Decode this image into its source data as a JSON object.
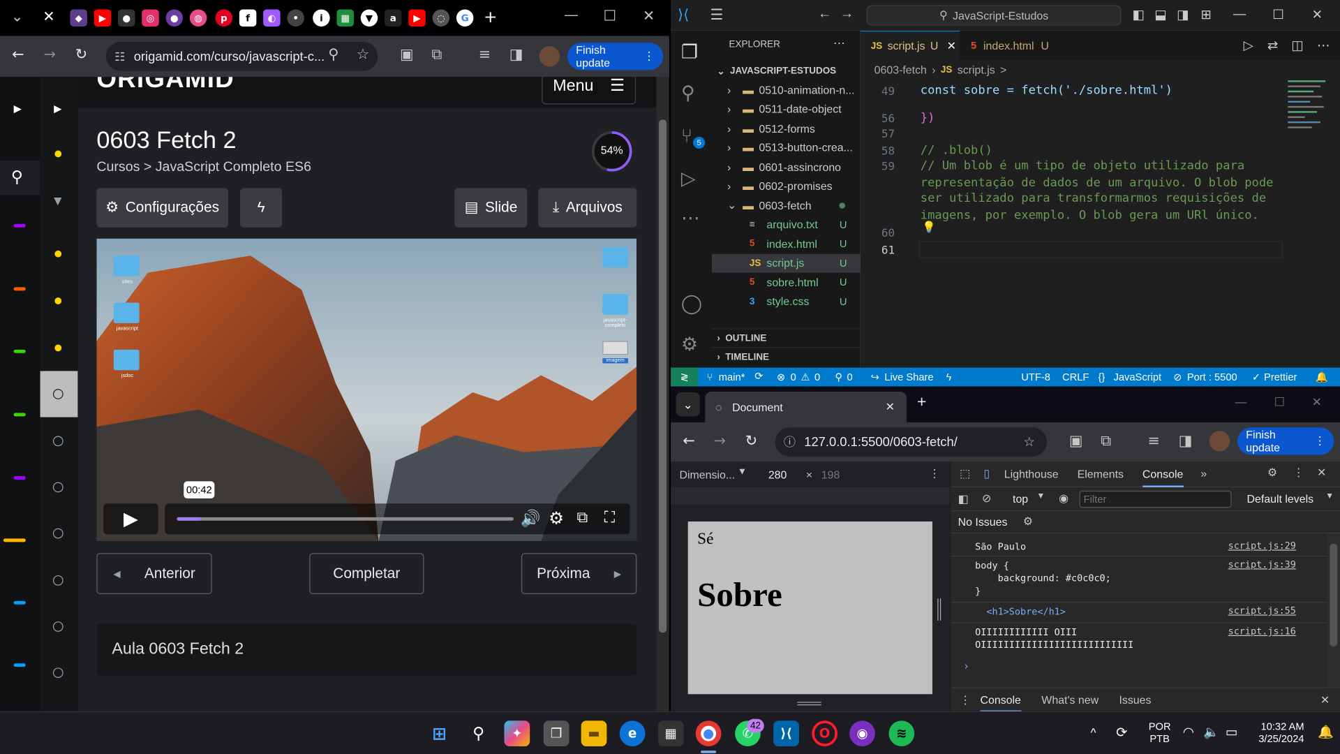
{
  "left_browser": {
    "address": "origamid.com/curso/javascript-c...",
    "update_label": "Finish update"
  },
  "page": {
    "logo": "ORIGAMID",
    "menu_label": "Menu",
    "title": "0603 Fetch 2",
    "breadcrumb": "Cursos > JavaScript Completo ES6",
    "progress_text": "54%",
    "progress_value": 0.54,
    "config_label": "Configurações",
    "slide_label": "Slide",
    "files_label": "Arquivos",
    "video_time": "00:42",
    "video_progress": 0.07,
    "desktop_labels": [
      "sites",
      "javascript",
      "jsdoc",
      "javascript-completo",
      "imagem"
    ],
    "prev_label": "Anterior",
    "complete_label": "Completar",
    "next_label": "Próxima",
    "lesson_label": "Aula 0603 Fetch 2"
  },
  "vscode": {
    "search_label": "JavaScript-Estudos",
    "explorer_label": "EXPLORER",
    "project_label": "JAVASCRIPT-ESTUDOS",
    "tabs": [
      {
        "label": "script.js",
        "badge": "U"
      },
      {
        "label": "index.html",
        "badge": "U"
      }
    ],
    "breadcrumb_folder": "0603-fetch",
    "breadcrumb_file": "script.js",
    "breadcrumb_tail": ">",
    "scm_badge": "5",
    "tree": [
      {
        "label": "0510-animation-n..."
      },
      {
        "label": "0511-date-object"
      },
      {
        "label": "0512-forms"
      },
      {
        "label": "0513-button-crea..."
      },
      {
        "label": "0601-assincrono"
      },
      {
        "label": "0602-promises"
      },
      {
        "label": "0603-fetch"
      }
    ],
    "files": [
      {
        "label": "arquivo.txt",
        "badge": "U"
      },
      {
        "label": "index.html",
        "badge": "U"
      },
      {
        "label": "script.js",
        "badge": "U"
      },
      {
        "label": "sobre.html",
        "badge": "U"
      },
      {
        "label": "style.css",
        "badge": "U"
      }
    ],
    "outline_label": "OUTLINE",
    "timeline_label": "TIMELINE",
    "code_lines": [
      {
        "num": "49",
        "text": "const sobre = fetch('./sobre.html')"
      },
      {
        "num": "56",
        "text": "})"
      },
      {
        "num": "57",
        "text": ""
      },
      {
        "num": "58",
        "text": "// .blob()"
      },
      {
        "num": "59",
        "text": "// Um blob é um tipo de objeto utilizado para"
      },
      {
        "num": "",
        "text": "representação de dados de um arquivo. O blob pode"
      },
      {
        "num": "",
        "text": "ser utilizado para transformarmos requisições de"
      },
      {
        "num": "",
        "text": "imagens, por exemplo. O blob gera um URl único."
      },
      {
        "num": "60",
        "text": ""
      },
      {
        "num": "61",
        "text": ""
      }
    ],
    "status": {
      "branch": "main*",
      "errors": "0",
      "warnings": "0",
      "ports": "0",
      "live_share": "Live Share",
      "encoding": "UTF-8",
      "eol": "CRLF",
      "language": "JavaScript",
      "port": "Port : 5500",
      "prettier": "Prettier"
    }
  },
  "right_browser": {
    "tab_title": "Document",
    "url": "127.0.0.1:5500/0603-fetch/",
    "update_label": "Finish update",
    "dimension_label": "Dimensio...",
    "width": "280",
    "height": "198",
    "preview_small": "Sé",
    "preview_heading": "Sobre",
    "devtools_tabs": [
      "Lighthouse",
      "Elements",
      "Console"
    ],
    "context": "top",
    "filter_placeholder": "Filter",
    "levels": "Default levels",
    "no_issues": "No Issues",
    "console": [
      {
        "text": "São Paulo",
        "source": "script.js:29"
      },
      {
        "text": "body {\n    background: #c0c0c0;\n}",
        "source": "script.js:39"
      },
      {
        "text": "  <h1>Sobre</h1>",
        "source": "script.js:55"
      },
      {
        "text": "OIIIIIIIIIIII OIII\nOIIIIIIIIIIIIIIIIIIIIIIIIIII",
        "source": "script.js:16"
      }
    ],
    "drawer_tabs": [
      "Console",
      "What's new",
      "Issues"
    ]
  },
  "taskbar": {
    "lang": "POR",
    "layout": "PTB",
    "time": "10:32 AM",
    "date": "3/25/2024",
    "whatsapp_badge": "42"
  },
  "colors": {
    "accent_blue": "#0b57d0",
    "vscode_status": "#007acc",
    "origamid_yellow": "#ffd400",
    "progress_purple": "#8e5cf6"
  }
}
